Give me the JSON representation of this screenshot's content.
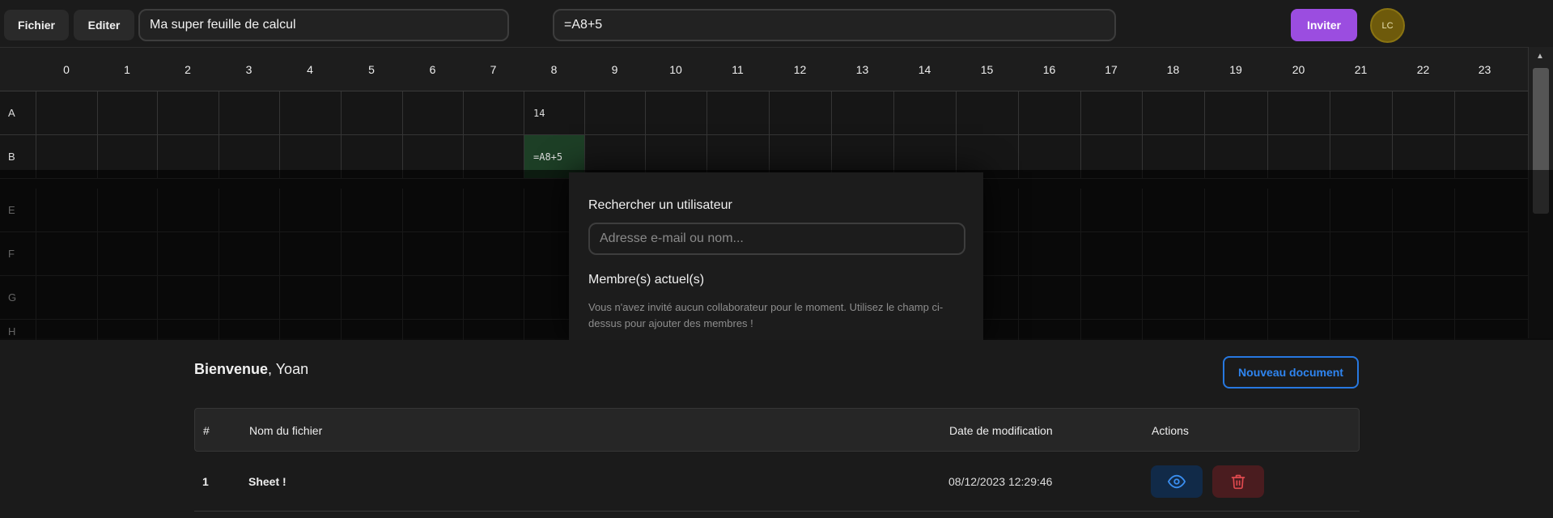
{
  "toolbar": {
    "file_label": "Fichier",
    "edit_label": "Editer",
    "doc_title": "Ma super feuille de calcul",
    "formula": "=A8+5",
    "invite_label": "Inviter",
    "avatar_initials": "LC"
  },
  "grid": {
    "columns": [
      "0",
      "1",
      "2",
      "3",
      "4",
      "5",
      "6",
      "7",
      "8",
      "9",
      "10",
      "11",
      "12",
      "13",
      "14",
      "15",
      "16",
      "17",
      "18",
      "19",
      "20",
      "21",
      "22",
      "23"
    ],
    "rows": [
      "A",
      "B",
      "E",
      "F",
      "G",
      "H"
    ],
    "cells": {
      "A8": "14",
      "B8": "=A8+5"
    },
    "active_cell": "B8"
  },
  "invite_modal": {
    "search_label": "Rechercher un utilisateur",
    "search_placeholder": "Adresse e-mail ou nom...",
    "members_label": "Membre(s) actuel(s)",
    "empty_note": "Vous n'avez invité aucun collaborateur pour le moment. Utilisez le champ ci-dessus pour ajouter des membres !"
  },
  "dashboard": {
    "welcome_bold": "Bienvenue",
    "welcome_name": ", Yoan",
    "new_doc_label": "Nouveau document",
    "table_headers": [
      "#",
      "Nom du fichier",
      "Date de modification",
      "Actions"
    ],
    "rows": [
      {
        "index": "1",
        "name": "Sheet !",
        "modified": "08/12/2023 12:29:46"
      }
    ]
  },
  "colors": {
    "accent_purple": "#9b4de0",
    "accent_blue": "#2778e0",
    "active_cell": "#1d3f26",
    "danger": "#e04a4f"
  }
}
